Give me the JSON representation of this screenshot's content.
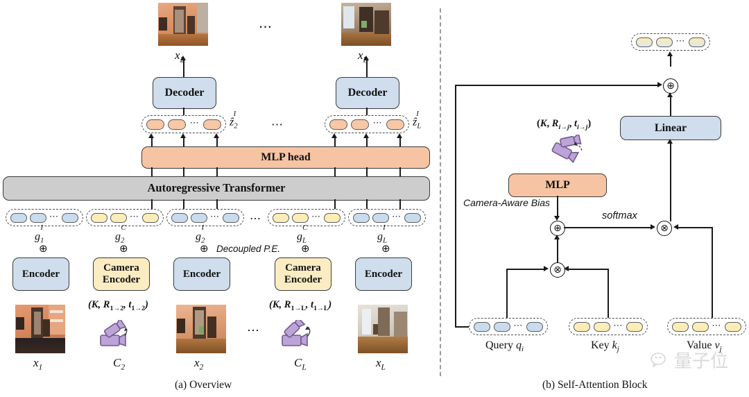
{
  "figure": {
    "panels": [
      {
        "id": "a",
        "caption": "(a) Overview"
      },
      {
        "id": "b",
        "caption": "(b) Self-Attention Block"
      }
    ]
  },
  "colors": {
    "blue_box": "#cfdded",
    "yellow_box": "#fcecc2",
    "orange_box": "#f7c4a3",
    "gray_box": "#cdcdcd",
    "camera_purple": "#b9a0d4",
    "outline": "#3a3a3a"
  },
  "overview": {
    "blocks": {
      "transformer": "Autoregressive Transformer",
      "mlp_head": "MLP head",
      "decoder": "Decoder",
      "encoder": "Encoder",
      "camera_encoder_line1": "Camera",
      "camera_encoder_line2": "Encoder"
    },
    "decoders": [
      {
        "label": "Decoder"
      },
      {
        "label": "Decoder"
      }
    ],
    "output_images": [
      {
        "caption_base": "x",
        "caption_sub": "2"
      },
      {
        "caption_base": "x",
        "caption_sub": "L"
      }
    ],
    "output_tokens": [
      {
        "label_base": "ẑ",
        "label_sub": "2",
        "label_sup": "I"
      },
      {
        "label_base": "ẑ",
        "label_sub": "L",
        "label_sup": "I"
      }
    ],
    "ellipsis": "⋯",
    "decoupled_pe": "Decoupled P.E.",
    "plus_symbol": "⊕",
    "input_tokens": [
      {
        "label_base": "g",
        "label_sub": "1",
        "label_sup": "I",
        "kind": "image"
      },
      {
        "label_base": "g",
        "label_sub": "2",
        "label_sup": "C",
        "kind": "camera"
      },
      {
        "label_base": "g",
        "label_sub": "2",
        "label_sup": "I",
        "kind": "image"
      },
      {
        "label_base": "g",
        "label_sub": "L",
        "label_sup": "C",
        "kind": "camera"
      },
      {
        "label_base": "g",
        "label_sub": "L",
        "label_sup": "I",
        "kind": "image"
      }
    ],
    "encoders": [
      {
        "type": "image",
        "label": "Encoder"
      },
      {
        "type": "camera",
        "label_line1": "Camera",
        "label_line2": "Encoder"
      },
      {
        "type": "image",
        "label": "Encoder"
      },
      {
        "type": "camera",
        "label_line1": "Camera",
        "label_line2": "Encoder"
      },
      {
        "type": "image",
        "label": "Encoder"
      }
    ],
    "inputs": [
      {
        "kind": "image",
        "caption_base": "x",
        "caption_sub": "1"
      },
      {
        "kind": "camera",
        "caption_base": "C",
        "caption_sub": "2",
        "params": "(K, R₁→₂, t₁→₂)"
      },
      {
        "kind": "image",
        "caption_base": "x",
        "caption_sub": "2"
      },
      {
        "kind": "camera",
        "caption_base": "C",
        "caption_sub": "L",
        "params": "(K, R₁→L, t₁→L)"
      },
      {
        "kind": "image",
        "caption_base": "x",
        "caption_sub": "L"
      }
    ]
  },
  "attention": {
    "blocks": {
      "mlp": "MLP",
      "linear": "Linear"
    },
    "camera_params": "(K, R i→j , t i→j )",
    "camera_params_parts": {
      "open": "(",
      "k": "K",
      "comma1": ", ",
      "r": "R",
      "r_sub": "i→j",
      "comma2": ", ",
      "t": "t",
      "t_sub": "i→j",
      "close": ")"
    },
    "labels": {
      "camera_aware_bias": "Camera-Aware Bias",
      "softmax": "softmax"
    },
    "operators": {
      "add": "⊕",
      "multiply": "⊗"
    },
    "inputs": [
      {
        "name": "Query",
        "sym_base": "q",
        "sym_sub": "i",
        "color": "blue"
      },
      {
        "name": "Key",
        "sym_base": "k",
        "sym_sub": "j",
        "color": "yellow"
      },
      {
        "name": "Value",
        "sym_base": "v",
        "sym_sub": "j",
        "color": "yellow"
      }
    ],
    "output_tokens": {
      "kind": "gradient"
    },
    "ellipsis": "⋯"
  },
  "watermark": {
    "text": "量子位"
  }
}
